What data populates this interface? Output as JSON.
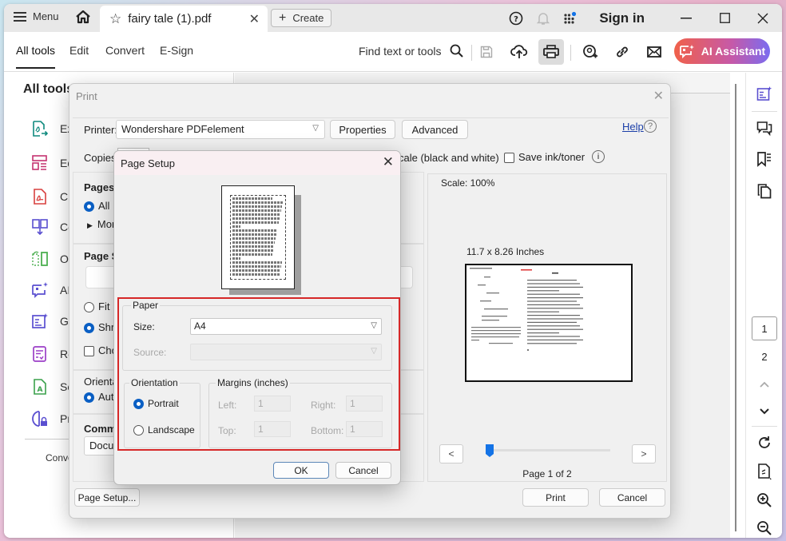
{
  "titlebar": {
    "menu_label": "Menu",
    "tab_title": "fairy tale (1).pdf",
    "create_label": "Create",
    "sign_in": "Sign in"
  },
  "toolbar": {
    "tabs": [
      {
        "label": "All tools",
        "active": true
      },
      {
        "label": "Edit",
        "active": false
      },
      {
        "label": "Convert",
        "active": false
      },
      {
        "label": "E-Sign",
        "active": false
      }
    ],
    "find_label": "Find text or tools",
    "ai_assistant_label": "AI Assistant",
    "ai_gradient": [
      "#f0614a",
      "#c659a8",
      "#7a6cf0"
    ]
  },
  "left_panel": {
    "title": "All tools",
    "items": [
      {
        "label": "Exp",
        "icon": "export-pdf-icon",
        "color": "#0f8a7e"
      },
      {
        "label": "Edi",
        "icon": "edit-pdf-icon",
        "color": "#c4326f"
      },
      {
        "label": "Cre",
        "icon": "create-pdf-icon",
        "color": "#d9403f"
      },
      {
        "label": "Co",
        "icon": "combine-files-icon",
        "color": "#5a4fd0"
      },
      {
        "label": "Org",
        "icon": "organize-pages-icon",
        "color": "#4caf50"
      },
      {
        "label": "AI A",
        "icon": "ai-assistant-icon",
        "color": "#5a4fd0"
      },
      {
        "label": "Ge",
        "icon": "generate-summary-icon",
        "color": "#5a4fd0"
      },
      {
        "label": "Re",
        "icon": "request-esign-icon",
        "color": "#9c3fc7"
      },
      {
        "label": "Sca",
        "icon": "scan-ocr-icon",
        "color": "#3aa14b"
      },
      {
        "label": "Pro",
        "icon": "protect-pdf-icon",
        "color": "#5a4fd0"
      }
    ],
    "footer_text": "Conve"
  },
  "right_rail": {
    "pages": [
      "1",
      "2"
    ],
    "current_page": "1"
  },
  "print_dialog": {
    "title": "Print",
    "printer_label": "Printer:",
    "printer_value": "Wondershare PDFelement",
    "properties_label": "Properties",
    "advanced_label": "Advanced",
    "help_label": "Help",
    "copies_label": "Copies:",
    "grayscale_label": "cale (black and white)",
    "save_ink_label": "Save ink/toner",
    "pages_heading": "Pages t",
    "pages_all": "All",
    "pages_more": "Mor",
    "page_size_heading": "Page Si",
    "fit_label": "Fit",
    "shrink_label": "Shri",
    "choose_label": "Cho",
    "orientation_heading": "Orienta",
    "orientation_auto": "Auto",
    "comments_heading": "Comme",
    "comments_value": "Docum",
    "page_setup_button": "Page Setup...",
    "preview": {
      "scale": "Scale: 100%",
      "page_size": "11.7 x 8.26 Inches",
      "prev": "<",
      "next": ">",
      "page_label": "Page 1 of 2",
      "slider_position": 0.0
    },
    "print_button": "Print",
    "cancel_button": "Cancel"
  },
  "page_setup": {
    "title": "Page Setup",
    "paper_legend": "Paper",
    "size_label": "Size:",
    "size_value": "A4",
    "source_label": "Source:",
    "source_value": "",
    "orientation_legend": "Orientation",
    "portrait_label": "Portrait",
    "landscape_label": "Landscape",
    "orientation_selected": "Portrait",
    "margins_legend": "Margins (inches)",
    "margins": {
      "left_label": "Left:",
      "left": "1",
      "right_label": "Right:",
      "right": "1",
      "top_label": "Top:",
      "top": "1",
      "bottom_label": "Bottom:",
      "bottom": "1"
    },
    "ok_label": "OK",
    "cancel_label": "Cancel",
    "highlight_color": "#d62828"
  }
}
